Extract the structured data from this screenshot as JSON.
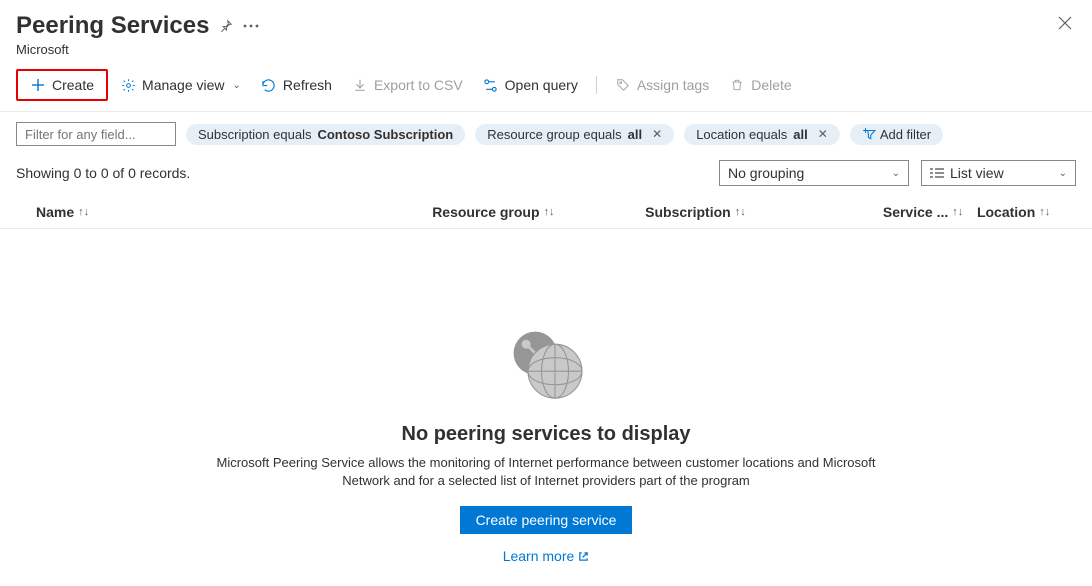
{
  "header": {
    "title": "Peering Services",
    "subtitle": "Microsoft"
  },
  "toolbar": {
    "create": "Create",
    "manage_view": "Manage view",
    "refresh": "Refresh",
    "export_csv": "Export to CSV",
    "open_query": "Open query",
    "assign_tags": "Assign tags",
    "delete": "Delete"
  },
  "filters": {
    "placeholder": "Filter for any field...",
    "subscription_prefix": "Subscription equals ",
    "subscription_value": "Contoso Subscription",
    "rg_prefix": "Resource group equals ",
    "rg_value": "all",
    "loc_prefix": "Location equals ",
    "loc_value": "all",
    "add_filter": "Add filter"
  },
  "status": {
    "records": "Showing 0 to 0 of 0 records.",
    "grouping": "No grouping",
    "view": "List view"
  },
  "columns": {
    "name": "Name",
    "rg": "Resource group",
    "sub": "Subscription",
    "svc": "Service ...",
    "loc": "Location"
  },
  "empty": {
    "title": "No peering services to display",
    "desc": "Microsoft Peering Service allows the monitoring of Internet performance between customer locations and Microsoft Network and for a selected list of Internet providers part of the program",
    "button": "Create peering service",
    "link": "Learn more"
  }
}
